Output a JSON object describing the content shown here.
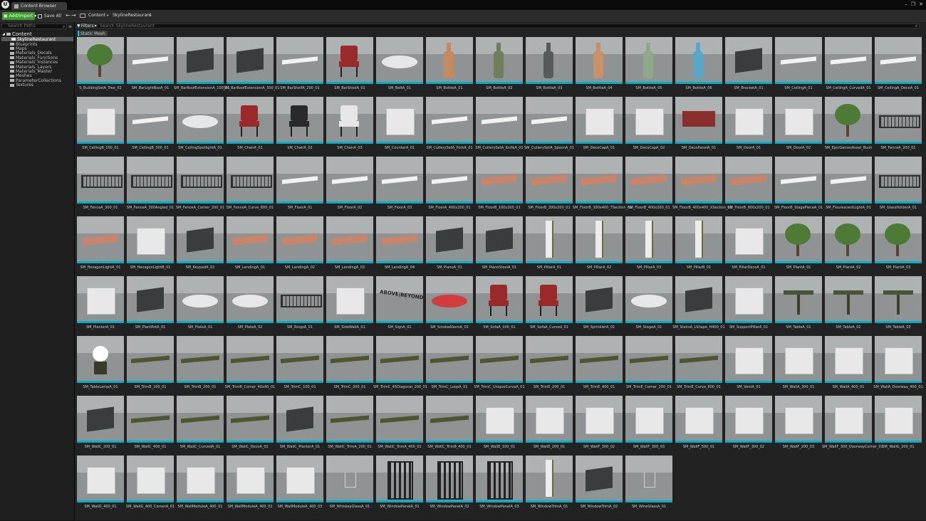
{
  "window": {
    "tab_title": "Content Browser",
    "controls": [
      "–",
      "❐",
      "✕"
    ]
  },
  "toolbar": {
    "add_import": "Add/Import",
    "save_all": "Save All"
  },
  "breadcrumb": {
    "root": "Content",
    "current": "SkylineRestaurant"
  },
  "sources": {
    "search_placeholder": "Search Paths",
    "root": "Content",
    "selected": "SkylineRestaurant",
    "children": [
      "Blueprints",
      "Maps",
      "Materials_Decals",
      "Materials_Functions",
      "Materials_Instances",
      "Materials_Layers",
      "Materials_Master",
      "Meshes",
      "ParameterCollections",
      "Textures"
    ]
  },
  "assets": {
    "filters_label": "Filters",
    "search_placeholder": "Search SkylineRestaurant",
    "active_filter": "Static Mesh",
    "items": [
      {
        "label": "S_BuildingSetA_Tree_02",
        "kind": "tree"
      },
      {
        "label": "SM_BarLightBoxA_01",
        "kind": "flat"
      },
      {
        "label": "SM_BarRoofExtensionA_100_01",
        "kind": "dark"
      },
      {
        "label": "SM_BarRoofExtensionA_300_01",
        "kind": "dark"
      },
      {
        "label": "SM_BarShelfA_200_01",
        "kind": "flat"
      },
      {
        "label": "SM_BarStoolA_01",
        "kind": "red"
      },
      {
        "label": "SM_BeltA_01",
        "kind": "round"
      },
      {
        "label": "SM_BottleA_01",
        "kind": "bottle",
        "color": "#c58a5e"
      },
      {
        "label": "SM_BottleA_02",
        "kind": "bottle",
        "color": "#6f7f5e"
      },
      {
        "label": "SM_BottleA_03",
        "kind": "bottle",
        "color": "#555a5a"
      },
      {
        "label": "SM_BottleA_04",
        "kind": "bottle",
        "color": "#c89168"
      },
      {
        "label": "SM_BottleA_05",
        "kind": "bottle",
        "color": "#8fa88a"
      },
      {
        "label": "SM_BottleA_06",
        "kind": "bottle",
        "color": "#5aa6c8"
      },
      {
        "label": "SM_BracketA_01",
        "kind": "dark"
      },
      {
        "label": "SM_CeilingA_01",
        "kind": "flat"
      },
      {
        "label": "SM_CeilingA_CurvedA_01",
        "kind": "flat"
      },
      {
        "label": "SM_CeilingA_DecoA_01",
        "kind": "flat"
      },
      {
        "label": "SM_CeilingB_100_01",
        "kind": "white"
      },
      {
        "label": "SM_CeilingB_300_01",
        "kind": "flat"
      },
      {
        "label": "SM_CeilingSpotlightA_01",
        "kind": "round"
      },
      {
        "label": "SM_ChairA_01",
        "kind": "red"
      },
      {
        "label": "SM_ChairA_02",
        "kind": "chair",
        "color": "#2a2a2a"
      },
      {
        "label": "SM_ChairA_03",
        "kind": "chair",
        "color": "#e6e6e6"
      },
      {
        "label": "SM_CounterA_01",
        "kind": "white"
      },
      {
        "label": "SM_CutlerySetA_ForkA_01",
        "kind": "flat"
      },
      {
        "label": "SM_CutlerySetA_KnifeA_01",
        "kind": "flat"
      },
      {
        "label": "SM_CutlerySetA_SpoonA_01",
        "kind": "flat"
      },
      {
        "label": "SM_DecoCapA_01",
        "kind": "white"
      },
      {
        "label": "SM_DecoCapA_02",
        "kind": "white"
      },
      {
        "label": "SM_DecoPanelA_01",
        "kind": "panelred"
      },
      {
        "label": "SM_DoorA_01",
        "kind": "white"
      },
      {
        "label": "SM_DoorA_02",
        "kind": "white"
      },
      {
        "label": "SM_EpicGamesAsset_Bush",
        "kind": "tree"
      },
      {
        "label": "SM_FenceA_200_01",
        "kind": "fence"
      },
      {
        "label": "SM_FenceA_300_01",
        "kind": "fence"
      },
      {
        "label": "SM_FenceA_300Angled_01",
        "kind": "fence"
      },
      {
        "label": "SM_FenceA_Corner_200_01",
        "kind": "fence"
      },
      {
        "label": "SM_FenceA_Curve_800_01",
        "kind": "fence"
      },
      {
        "label": "SM_FloorA_01",
        "kind": "flat"
      },
      {
        "label": "SM_FloorA_02",
        "kind": "flat"
      },
      {
        "label": "SM_FloorA_03",
        "kind": "flat"
      },
      {
        "label": "SM_FloorA_400x200_01",
        "kind": "flat"
      },
      {
        "label": "SM_FloorB_100x200_01",
        "kind": "wood"
      },
      {
        "label": "SM_FloorB_300x200_01",
        "kind": "wood"
      },
      {
        "label": "SM_FloorB_300x400_TSection_01",
        "kind": "wood"
      },
      {
        "label": "SM_FloorB_400x200_01",
        "kind": "wood"
      },
      {
        "label": "SM_FloorB_400x400_XSection_01",
        "kind": "wood"
      },
      {
        "label": "SM_FloorB_800x200_01",
        "kind": "wood"
      },
      {
        "label": "SM_FloorB_StagePieceA_01",
        "kind": "flat"
      },
      {
        "label": "SM_FlourescentLightA_01",
        "kind": "flat"
      },
      {
        "label": "SM_GlassHolderA_01",
        "kind": "fence"
      },
      {
        "label": "SM_HexagonLightA_01",
        "kind": "wood"
      },
      {
        "label": "SM_HexagonLightB_01",
        "kind": "white"
      },
      {
        "label": "SM_KeypadA_01",
        "kind": "dark"
      },
      {
        "label": "SM_LandingA_01",
        "kind": "wood"
      },
      {
        "label": "SM_LandingA_02",
        "kind": "wood"
      },
      {
        "label": "SM_LandingA_03",
        "kind": "wood"
      },
      {
        "label": "SM_LandingA_04",
        "kind": "wood"
      },
      {
        "label": "SM_PianoA_01",
        "kind": "dark"
      },
      {
        "label": "SM_PianoStoolA_01",
        "kind": "dark"
      },
      {
        "label": "SM_PillarA_01",
        "kind": "pillar"
      },
      {
        "label": "SM_PillarA_02",
        "kind": "pillar"
      },
      {
        "label": "SM_PillarA_03",
        "kind": "pillar"
      },
      {
        "label": "SM_PillarB_01",
        "kind": "pillar"
      },
      {
        "label": "SM_PillarDecoA_01",
        "kind": "white"
      },
      {
        "label": "SM_PlantA_01",
        "kind": "plant"
      },
      {
        "label": "SM_PlantA_02",
        "kind": "plant"
      },
      {
        "label": "SM_PlantA_03",
        "kind": "plant"
      },
      {
        "label": "SM_PlanterA_01",
        "kind": "white"
      },
      {
        "label": "SM_PlantPotA_01",
        "kind": "dark"
      },
      {
        "label": "SM_PlateA_01",
        "kind": "round"
      },
      {
        "label": "SM_PlateA_02",
        "kind": "round"
      },
      {
        "label": "SM_RingsA_01",
        "kind": "fence"
      },
      {
        "label": "SM_SideWallA_01",
        "kind": "white"
      },
      {
        "label": "SM_SignA_01",
        "kind": "sign"
      },
      {
        "label": "SM_SmokeAlarmA_01",
        "kind": "roundred"
      },
      {
        "label": "SM_SofaA_100_01",
        "kind": "red"
      },
      {
        "label": "SM_SofaA_Curved_01",
        "kind": "red"
      },
      {
        "label": "SM_SprinklerA_01",
        "kind": "dark"
      },
      {
        "label": "SM_StageA_01",
        "kind": "round"
      },
      {
        "label": "SM_StairsA_LShape_H400_01",
        "kind": "dark"
      },
      {
        "label": "SM_SupportPillarA_01",
        "kind": "white"
      },
      {
        "label": "SM_TableA_01",
        "kind": "table"
      },
      {
        "label": "SM_TableA_02",
        "kind": "table"
      },
      {
        "label": "SM_TableA_03",
        "kind": "table"
      },
      {
        "label": "SM_TableLampA_01",
        "kind": "lamp"
      },
      {
        "label": "SM_TrimB_100_01",
        "kind": "trim"
      },
      {
        "label": "SM_TrimB_200_01",
        "kind": "trim"
      },
      {
        "label": "SM_TrimB_Corner_40x40_01",
        "kind": "trim"
      },
      {
        "label": "SM_TrimC_100_01",
        "kind": "trim"
      },
      {
        "label": "SM_TrimC_200_01",
        "kind": "trim"
      },
      {
        "label": "SM_TrimC_45Diagonal_200_01",
        "kind": "trim"
      },
      {
        "label": "SM_TrimC_LoopA_01",
        "kind": "trim"
      },
      {
        "label": "SM_TrimC_UniqueCurveA_01",
        "kind": "trim"
      },
      {
        "label": "SM_TrimE_200_01",
        "kind": "trim"
      },
      {
        "label": "SM_TrimE_400_01",
        "kind": "trim"
      },
      {
        "label": "SM_TrimE_Corner_200_01",
        "kind": "trim"
      },
      {
        "label": "SM_TrimE_Curve_800_01",
        "kind": "trim"
      },
      {
        "label": "SM_VentA_01",
        "kind": "white"
      },
      {
        "label": "SM_WallA_300_01",
        "kind": "white"
      },
      {
        "label": "SM_WallA_400_01",
        "kind": "white"
      },
      {
        "label": "SM_WallA_Doorway_400_01",
        "kind": "white"
      },
      {
        "label": "SM_WallC_200_01",
        "kind": "dark"
      },
      {
        "label": "SM_WallC_400_01",
        "kind": "trim"
      },
      {
        "label": "SM_WallC_CurvedA_01",
        "kind": "trim"
      },
      {
        "label": "SM_WallC_DecoA_01",
        "kind": "trim"
      },
      {
        "label": "SM_WallC_PlanterA_01",
        "kind": "dark"
      },
      {
        "label": "SM_WallC_TrimA_200_01",
        "kind": "trim"
      },
      {
        "label": "SM_WallC_TrimA_400_01",
        "kind": "trim"
      },
      {
        "label": "SM_WallC_TrimB_400_01",
        "kind": "trim"
      },
      {
        "label": "SM_WallE_100_01",
        "kind": "white"
      },
      {
        "label": "SM_WallE_200_01",
        "kind": "white"
      },
      {
        "label": "SM_WallF_300_02",
        "kind": "white"
      },
      {
        "label": "SM_WallF_300_03",
        "kind": "white"
      },
      {
        "label": "SM_WallF_500_01",
        "kind": "white"
      },
      {
        "label": "SM_WallF_300_02",
        "kind": "white"
      },
      {
        "label": "SM_WallF_200_03",
        "kind": "white"
      },
      {
        "label": "SM_WallF_300_DoorwayCorner_01",
        "kind": "white"
      },
      {
        "label": "SM_WallG_200_01",
        "kind": "white"
      },
      {
        "label": "SM_WallG_400_01",
        "kind": "white"
      },
      {
        "label": "SM_WallG_400_CornerA_01",
        "kind": "white"
      },
      {
        "label": "SM_WallModuleA_400_01",
        "kind": "white"
      },
      {
        "label": "SM_WallModuleA_400_02",
        "kind": "white"
      },
      {
        "label": "SM_WallModuleA_400_03",
        "kind": "white"
      },
      {
        "label": "SM_WhiskeyGlassA_01",
        "kind": "glass"
      },
      {
        "label": "SM_WindowPanelA_01",
        "kind": "window"
      },
      {
        "label": "SM_WindowPanelA_02",
        "kind": "window"
      },
      {
        "label": "SM_WindowPanelA_03",
        "kind": "window"
      },
      {
        "label": "SM_WindowTrimA_01",
        "kind": "pillar"
      },
      {
        "label": "SM_WindowTrimA_02",
        "kind": "dark"
      },
      {
        "label": "SM_WineGlassA_01",
        "kind": "glass"
      }
    ]
  },
  "colors": {
    "accent": "#00aec8",
    "add_button": "#3e9b2e",
    "selection": "#5a5a5a"
  },
  "sign_text": {
    "line1": "ABOVE|BEYOND"
  }
}
